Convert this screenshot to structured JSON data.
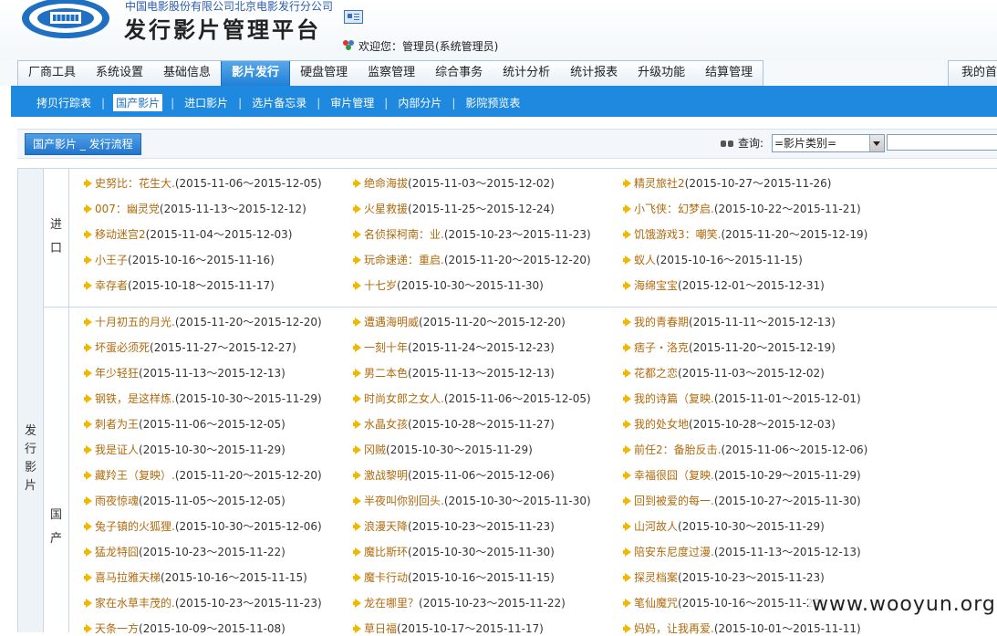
{
  "header": {
    "company": "中国电影股份有限公司北京电影发行分公司",
    "platform_title": "发行影片管理平台",
    "welcome": "欢迎您：管理员(系统管理员)"
  },
  "main_tabs": [
    "厂商工具",
    "系统设置",
    "基础信息",
    "影片发行",
    "硬盘管理",
    "监察管理",
    "综合事务",
    "统计分析",
    "统计报表",
    "升级功能",
    "结算管理"
  ],
  "main_tab_active": "影片发行",
  "main_tab_right": "我的首页",
  "sub_tabs": [
    "拷贝行踪表",
    "国产影片",
    "进口影片",
    "选片备忘录",
    "审片管理",
    "内部分片",
    "影院预览表"
  ],
  "sub_tab_active": "国产影片",
  "breadcrumb": "国产影片 _ 发行流程",
  "query": {
    "label": "查询:",
    "select_value": "=影片类别=",
    "input_value": ""
  },
  "categories": {
    "main": "发行影片",
    "import": "进口",
    "domestic": "国产"
  },
  "import_films": [
    [
      "史努比：花生大.",
      "(2015-11-06～2015-12-05)"
    ],
    [
      "绝命海拔",
      "(2015-11-03～2015-12-02)"
    ],
    [
      "精灵旅社2",
      "(2015-10-27～2015-11-26)"
    ],
    [
      "007：幽灵党",
      "(2015-11-13～2015-12-12)"
    ],
    [
      "火星救援",
      "(2015-11-25～2015-12-24)"
    ],
    [
      "小飞侠：幻梦启.",
      "(2015-10-22～2015-11-21)"
    ],
    [
      "移动迷宫2",
      "(2015-11-04～2015-12-03)"
    ],
    [
      "名侦探柯南：业.",
      "(2015-10-23～2015-11-23)"
    ],
    [
      "饥饿游戏3：嘲笑.",
      "(2015-11-20～2015-12-19)"
    ],
    [
      "小王子",
      "(2015-10-16～2015-11-16)"
    ],
    [
      "玩命速递：重启.",
      "(2015-11-20～2015-12-20)"
    ],
    [
      "蚁人",
      "(2015-10-16～2015-11-15)"
    ],
    [
      "幸存者",
      "(2015-10-18～2015-11-17)"
    ],
    [
      "十七岁",
      "(2015-10-30～2015-11-30)"
    ],
    [
      "海绵宝宝",
      "(2015-12-01～2015-12-31)"
    ]
  ],
  "domestic_films": [
    [
      "十月初五的月光.",
      "(2015-11-20～2015-12-20)"
    ],
    [
      "遭遇海明威",
      "(2015-11-20～2015-12-20)"
    ],
    [
      "我的青春期",
      "(2015-11-11～2015-12-13)"
    ],
    [
      "坏蛋必须死",
      "(2015-11-27～2015-12-27)"
    ],
    [
      "一刻十年",
      "(2015-11-24～2015-12-23)"
    ],
    [
      "痞子・洛克",
      "(2015-11-20～2015-12-19)"
    ],
    [
      "年少轻狂",
      "(2015-11-13～2015-12-13)"
    ],
    [
      "男二本色",
      "(2015-11-13～2015-12-13)"
    ],
    [
      "花都之恋",
      "(2015-11-03～2015-12-02)"
    ],
    [
      "钢铁，是这样炼.",
      "(2015-10-30～2015-11-29)"
    ],
    [
      "时尚女郎之女人.",
      "(2015-11-06～2015-12-05)"
    ],
    [
      "我的诗篇（复映.",
      "(2015-11-01～2015-12-01)"
    ],
    [
      "刺者为王",
      "(2015-11-06～2015-12-05)"
    ],
    [
      "水晶女孩",
      "(2015-10-28～2015-11-27)"
    ],
    [
      "我的处女地",
      "(2015-10-28～2015-12-03)"
    ],
    [
      "我是证人",
      "(2015-10-30～2015-11-29)"
    ],
    [
      "冈贼",
      "(2015-10-30～2015-11-29)"
    ],
    [
      "前任2：备胎反击.",
      "(2015-11-06～2015-12-06)"
    ],
    [
      "藏羚王（复映）.",
      "(2015-11-20～2015-12-20)"
    ],
    [
      "激战黎明",
      "(2015-11-06～2015-12-06)"
    ],
    [
      "幸福很囧（复映.",
      "(2015-10-29～2015-11-29)"
    ],
    [
      "雨夜惊魂",
      "(2015-11-05～2015-12-05)"
    ],
    [
      "半夜叫你别回头.",
      "(2015-10-30～2015-11-30)"
    ],
    [
      "回到被爱的每一.",
      "(2015-10-27～2015-11-30)"
    ],
    [
      "兔子镇的火狐狸.",
      "(2015-10-30～2015-12-06)"
    ],
    [
      "浪漫天降",
      "(2015-10-23～2015-11-23)"
    ],
    [
      "山河故人",
      "(2015-10-30～2015-11-29)"
    ],
    [
      "猛龙特囧",
      "(2015-10-23～2015-11-22)"
    ],
    [
      "魔比斯环",
      "(2015-10-30～2015-11-30)"
    ],
    [
      "陪安东尼度过漫.",
      "(2015-11-13～2015-12-13)"
    ],
    [
      "喜马拉雅天梯",
      "(2015-10-16～2015-11-15)"
    ],
    [
      "魔卡行动",
      "(2015-10-16～2015-11-15)"
    ],
    [
      "探灵档案",
      "(2015-10-23～2015-11-23)"
    ],
    [
      "家在水草丰茂的.",
      "(2015-10-23～2015-11-23)"
    ],
    [
      "龙在哪里？",
      "(2015-10-23～2015-11-22)"
    ],
    [
      "笔仙魔咒",
      "(2015-10-16～2015-11-22)"
    ],
    [
      "天条一方",
      "(2015-10-09～2015-11-08)"
    ],
    [
      "草日福",
      "(2015-10-17～2015-11-17)"
    ],
    [
      "妈妈，让我再爱.",
      "(2015-10-01～2015-11-11)"
    ]
  ],
  "watermark": "www.wooyun.org"
}
